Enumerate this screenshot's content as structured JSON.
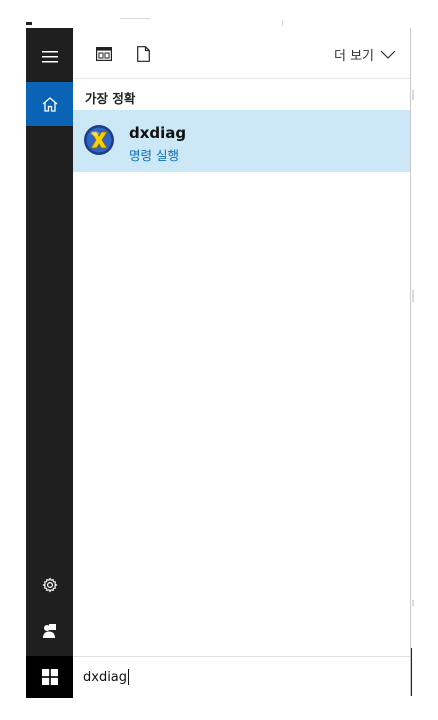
{
  "toolbar": {
    "more_label": "더 보기"
  },
  "section": {
    "best_match_label": "가장 정확"
  },
  "result": {
    "name": "dxdiag",
    "subtitle": "명령 실행"
  },
  "search": {
    "value": "dxdiag"
  },
  "colors": {
    "rail": "#1f1f1f",
    "accent": "#0b63b6",
    "result_highlight": "#cce8f6",
    "result_sub": "#0a6fb7"
  },
  "icons": {
    "menu": "hamburger-icon",
    "home": "home-icon",
    "settings": "gear-icon",
    "user": "user-icon",
    "start": "windows-logo-icon",
    "apps": "app-window-icon",
    "documents": "document-icon",
    "more": "chevron-down-icon",
    "result": "directx-icon"
  }
}
